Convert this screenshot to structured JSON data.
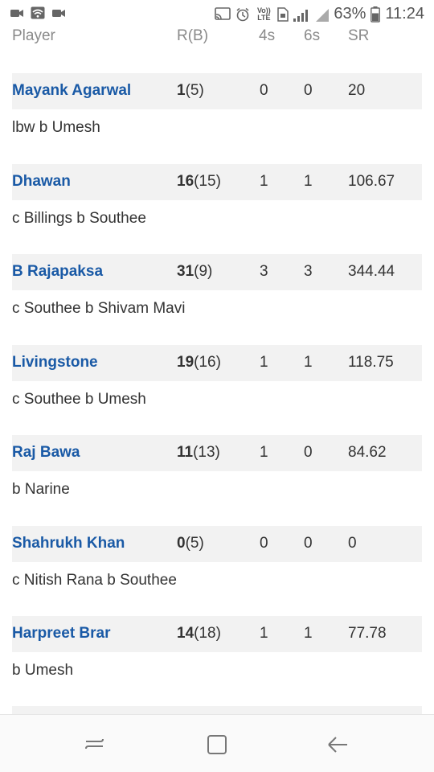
{
  "status_bar": {
    "battery": "63%",
    "time": "11:24",
    "volte": "Vo)) LTE",
    "lte": "LTE",
    "icons_left": [
      "video-icon",
      "wifi-icon",
      "camera-icon"
    ],
    "icons_right": [
      "cast-icon",
      "alarm-icon",
      "volte-icon",
      "sim-icon",
      "signal-icon",
      "battery-icon"
    ]
  },
  "table": {
    "headers": {
      "player": "Player",
      "rb": "R(B)",
      "fours": "4s",
      "sixes": "6s",
      "sr": "SR"
    },
    "rows": [
      {
        "name": "Mayank Agarwal",
        "runs": "1",
        "balls": "(5)",
        "fours": "0",
        "sixes": "0",
        "sr": "20",
        "dismissal": "lbw b Umesh"
      },
      {
        "name": "Dhawan",
        "runs": "16",
        "balls": "(15)",
        "fours": "1",
        "sixes": "1",
        "sr": "106.67",
        "dismissal": "c Billings b Southee"
      },
      {
        "name": "B Rajapaksa",
        "runs": "31",
        "balls": "(9)",
        "fours": "3",
        "sixes": "3",
        "sr": "344.44",
        "dismissal": "c Southee b Shivam Mavi"
      },
      {
        "name": "Livingstone",
        "runs": "19",
        "balls": "(16)",
        "fours": "1",
        "sixes": "1",
        "sr": "118.75",
        "dismissal": "c Southee b Umesh"
      },
      {
        "name": "Raj Bawa",
        "runs": "11",
        "balls": "(13)",
        "fours": "1",
        "sixes": "0",
        "sr": "84.62",
        "dismissal": "b Narine"
      },
      {
        "name": "Shahrukh Khan",
        "runs": "0",
        "balls": "(5)",
        "fours": "0",
        "sixes": "0",
        "sr": "0",
        "dismissal": "c Nitish Rana b Southee"
      },
      {
        "name": "Harpreet Brar",
        "runs": "14",
        "balls": "(18)",
        "fours": "1",
        "sixes": "1",
        "sr": "77.78",
        "dismissal": "b Umesh"
      }
    ]
  },
  "nav": {
    "buttons": [
      "recent-apps-icon",
      "home-icon",
      "back-icon"
    ]
  },
  "colors": {
    "player_name": "#1a5aa6",
    "row_bg": "#f2f2f2",
    "header_text": "#8a8a8a"
  }
}
